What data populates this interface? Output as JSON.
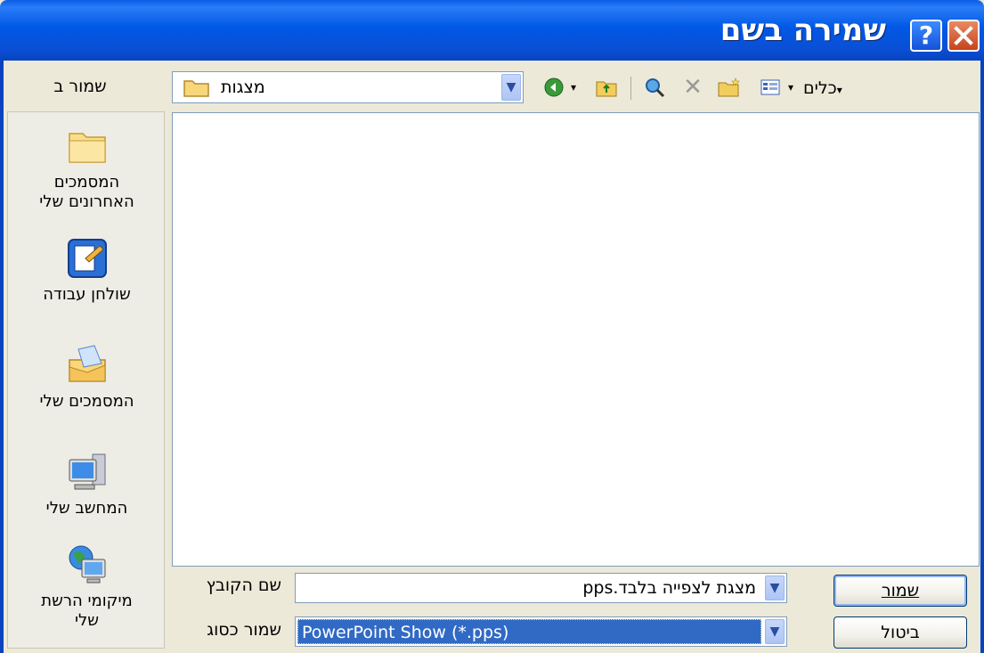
{
  "window": {
    "title": "שמירה בשם",
    "help_label": "?",
    "close_label": "✕"
  },
  "toolbar": {
    "save_in_label": "שמור ב",
    "location_value": "מצגות",
    "tools_label": "כלים",
    "icons": [
      "back-icon",
      "up-folder-icon",
      "search-web-icon",
      "delete-icon",
      "new-folder-icon",
      "views-icon"
    ]
  },
  "places": [
    {
      "label_line1": "המסמכים",
      "label_line2": "האחרונים שלי",
      "icon": "recent-folder-icon"
    },
    {
      "label_line1": "שולחן עבודה",
      "label_line2": "",
      "icon": "desktop-icon"
    },
    {
      "label_line1": "המסמכים שלי",
      "label_line2": "",
      "icon": "my-documents-icon"
    },
    {
      "label_line1": "המחשב שלי",
      "label_line2": "",
      "icon": "my-computer-icon"
    },
    {
      "label_line1": "מיקומי הרשת",
      "label_line2": "שלי",
      "icon": "network-places-icon"
    }
  ],
  "form": {
    "filename_label": "שם הקובץ",
    "filename_value": "מצגת לצפייה בלבד.pps",
    "filetype_label": "שמור כסוג",
    "filetype_value": "PowerPoint Show (*.pps)"
  },
  "buttons": {
    "save_label": "שמור",
    "cancel_label": "ביטול"
  },
  "colors": {
    "title_bar": "#0058e6",
    "selection": "#316ac5"
  }
}
